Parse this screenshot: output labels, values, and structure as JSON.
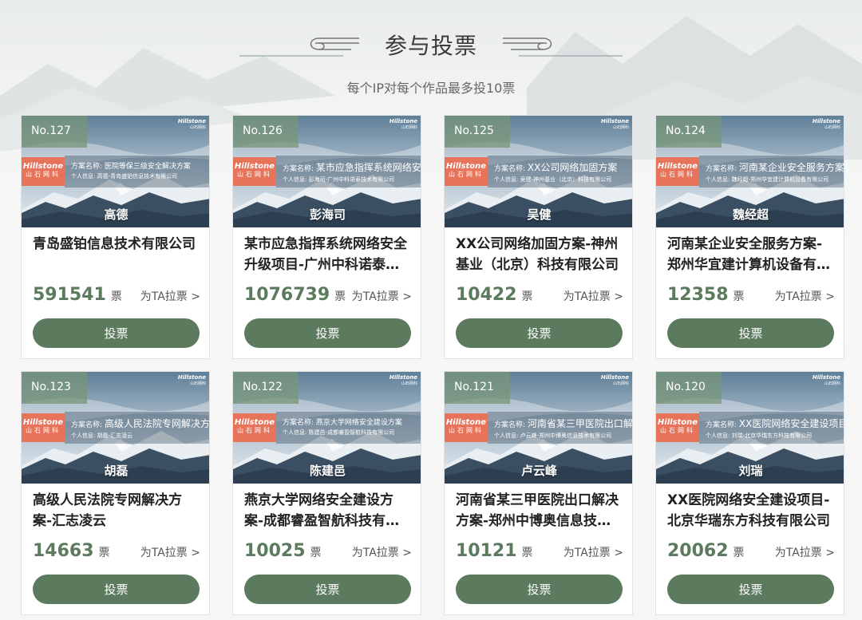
{
  "header": {
    "title": "参与投票",
    "subtitle": "每个IP对每个作品最多投10票"
  },
  "card_labels": {
    "vote_unit": "票",
    "canvass": "为TA拉票 >",
    "vote_button": "投票",
    "brand_en": "Hillstone",
    "brand_cn": "山石网科",
    "scheme_label": "方案名称:",
    "person_label": "个人信息:"
  },
  "colors": {
    "accent_green": "#5b7a5e",
    "brand_orange": "#e7735a"
  },
  "cards": [
    {
      "no": "No.127",
      "name": "高德",
      "scheme": "医院等保三级安全解决方案",
      "scheme_big": false,
      "person": "高德-青岛盛铂信息技术有限公司",
      "title": "青岛盛铂信息技术有限公司",
      "votes": "591541"
    },
    {
      "no": "No.126",
      "name": "彭海司",
      "scheme": "某市应急指挥系统网络安全升级项目",
      "scheme_big": true,
      "person": "彭海司-广州中科诺泰技术有限公司",
      "title": "某市应急指挥系统网络安全升级项目-广州中科诺泰技术有限公司",
      "votes": "1076739"
    },
    {
      "no": "No.125",
      "name": "吴健",
      "scheme": "XX公司网络加固方案",
      "scheme_big": true,
      "person": "吴健-神州基业（北京）科技有限公司",
      "title": "XX公司网络加固方案-神州基业（北京）科技有限公司",
      "votes": "10422"
    },
    {
      "no": "No.124",
      "name": "魏经超",
      "scheme": "河南某企业安全服务方案",
      "scheme_big": true,
      "person": "魏经超-郑州华宜建计算机设备有限公司",
      "title": "河南某企业安全服务方案-郑州华宜建计算机设备有限公司",
      "votes": "12358"
    },
    {
      "no": "No.123",
      "name": "胡磊",
      "scheme": "高级人民法院专网解决方案",
      "scheme_big": true,
      "person": "胡磊-汇志凌云",
      "title": "高级人民法院专网解决方案-汇志凌云",
      "votes": "14663"
    },
    {
      "no": "No.122",
      "name": "陈建邑",
      "scheme": "燕京大学网络安全建设方案",
      "scheme_big": false,
      "person": "陈建邑-成都睿盈智航科技有限公司",
      "title": "燕京大学网络安全建设方案-成都睿盈智航科技有限公司",
      "votes": "10025"
    },
    {
      "no": "No.121",
      "name": "卢云峰",
      "scheme": "河南省某三甲医院出口解决方案",
      "scheme_big": true,
      "person": "卢云峰-郑州中博奥信息技术有限公司",
      "title": "河南省某三甲医院出口解决方案-郑州中博奥信息技术有限公司",
      "votes": "10121"
    },
    {
      "no": "No.120",
      "name": "刘瑞",
      "scheme": "XX医院网络安全建设项目",
      "scheme_big": true,
      "person": "刘瑞-北京华瑞东方科技有限公司",
      "title": "XX医院网络安全建设项目-北京华瑞东方科技有限公司",
      "votes": "20062"
    }
  ]
}
